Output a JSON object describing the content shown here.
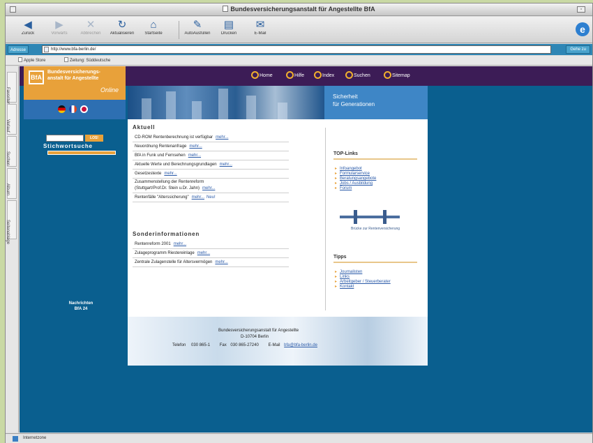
{
  "window": {
    "title": "Bundesversicherungsanstalt für Angestellte BfA"
  },
  "toolbar": {
    "buttons": [
      {
        "label": "Zurück",
        "icon": "back-arrow-icon",
        "enabled": true
      },
      {
        "label": "Vorwärts",
        "icon": "forward-arrow-icon",
        "enabled": false
      },
      {
        "label": "Abbrechen",
        "icon": "stop-icon",
        "enabled": false
      },
      {
        "label": "Aktualisieren",
        "icon": "refresh-icon",
        "enabled": true
      },
      {
        "label": "Startseite",
        "icon": "home-icon",
        "enabled": true
      },
      {
        "label": "AutoAusfüllen",
        "icon": "autofill-icon",
        "enabled": true
      },
      {
        "label": "Drucken",
        "icon": "print-icon",
        "enabled": true
      },
      {
        "label": "E-Mail",
        "icon": "mail-icon",
        "enabled": true
      }
    ]
  },
  "address": {
    "label": "Adresse",
    "url": "http://www.bfa-berlin.de/",
    "go": "Gehe zu"
  },
  "favorites": [
    {
      "label": "Apple Store"
    },
    {
      "label": "Zeitung: Süddeutsche"
    }
  ],
  "explorer_tabs": [
    "Favoriten",
    "Verlauf",
    "Suchen",
    "Album",
    "Seitenablage"
  ],
  "site": {
    "nav": [
      "Home",
      "Hilfe",
      "Index",
      "Suchen",
      "Sitemap"
    ],
    "logo": {
      "mark": "BfA",
      "line1": "Bundesversicherungs-",
      "line2": "anstalt für Angestellte",
      "line3": "Online"
    },
    "search": {
      "button": "LOS!",
      "title": "Stichwortsuche"
    },
    "side_link": [
      "Nachrichten",
      "BfA 24"
    ],
    "banner": {
      "slogan1": "Sicherheit",
      "slogan2": "für Generationen"
    },
    "aktuell": {
      "title": "Aktuell",
      "rows": [
        {
          "text": "CD-ROM Rentenberechnung ist verfügbar",
          "more": "mehr..."
        },
        {
          "text": "Neuordnung Rentenanfrage",
          "more": "mehr..."
        },
        {
          "text": "BfA in Funk und Fernsehen",
          "more": "mehr..."
        },
        {
          "text": "Aktuelle Werte und Berechnungsgrundlagen",
          "more": "mehr..."
        },
        {
          "text": "Gesetzestexte",
          "more": "mehr..."
        },
        {
          "text": "Zusammenstellung der Rentenreform\n(Stuttgart/Prof.Dr. Stein u.Dr. Jahn)",
          "more": "mehr..."
        },
        {
          "text": "Rentenfälle \"Alterssicherung\"",
          "more": "mehr...",
          "extra": "Neu!"
        }
      ]
    },
    "sonder": {
      "title": "Sonderinformationen",
      "rows": [
        {
          "text": "Rentenreform 2001",
          "more": "mehr..."
        },
        {
          "text": "Zulageprogramm Riestereinlage",
          "more": "mehr..."
        },
        {
          "text": "Zentrale Zulagenstelle für Altersvermögen",
          "more": "mehr..."
        }
      ]
    },
    "top_links": {
      "title": "TOP-Links",
      "items": [
        "Infoangebot",
        "Formularservice",
        "Beratungsangebote",
        "Jobs / Ausbildung",
        "Forum"
      ]
    },
    "bridge_caption": "Brücke zur Rentenversicherung",
    "tipps": {
      "title": "Tipps",
      "items": [
        "Journalisten",
        "Links",
        "Arbeitgeber / Steuerberater",
        "Kontakt"
      ]
    },
    "footer": {
      "org": "Bundesversicherungsanstalt für Angestellte",
      "address": "D-10704 Berlin",
      "phone_label": "Telefon",
      "phone": "030 865-1",
      "fax_label": "Fax",
      "fax": "030 865-27240",
      "mail_label": "E-Mail",
      "mail": "bfa@bfa-berlin.de"
    }
  },
  "status": {
    "text": "Internetzone"
  }
}
